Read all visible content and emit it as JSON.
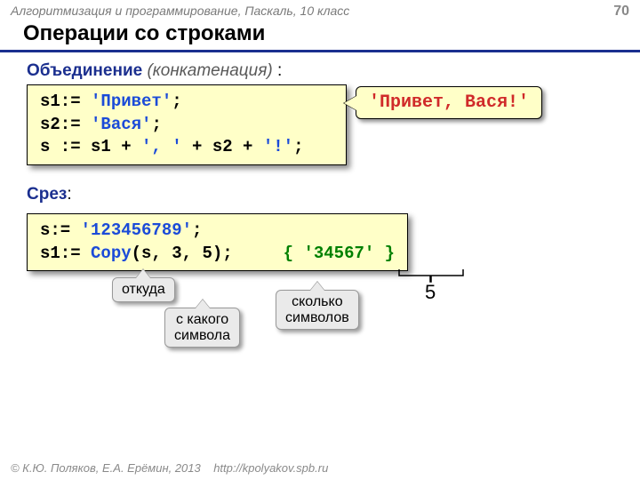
{
  "header": {
    "course": "Алгоритмизация и программирование, Паскаль, 10 класс",
    "page": "70"
  },
  "title": "Операции со строками",
  "section1": {
    "word": "Объединение",
    "paren": "(конкатенация)",
    "tail": " :",
    "code_l1a": "s1:= ",
    "code_l1b": "'Привет'",
    "code_l1c": ";",
    "code_l2a": "s2:= ",
    "code_l2b": "'Вася'",
    "code_l2c": ";",
    "code_l3a": "s := s1 + ",
    "code_l3b": "', '",
    "code_l3c": " + s2 + ",
    "code_l3d": "'!'",
    "code_l3e": ";",
    "result": "'Привет, Вася!'"
  },
  "section2": {
    "word": "Срез",
    "tail": ":",
    "code_l1a": "s:= ",
    "code_l1b": "'123456789'",
    "code_l1c": ";",
    "code_l2a": "s1:= ",
    "code_l2b": "Copy",
    "code_l2c": "(s, 3, 5);     ",
    "code_l2d": "{ '34567' }",
    "note1": "откуда",
    "note2": "с какого\nсимвола",
    "note3": "сколько\nсимволов",
    "five": "5"
  },
  "footer": {
    "copyright": "© К.Ю. Поляков, Е.А. Ерёмин, 2013",
    "url": "http://kpolyakov.spb.ru"
  }
}
